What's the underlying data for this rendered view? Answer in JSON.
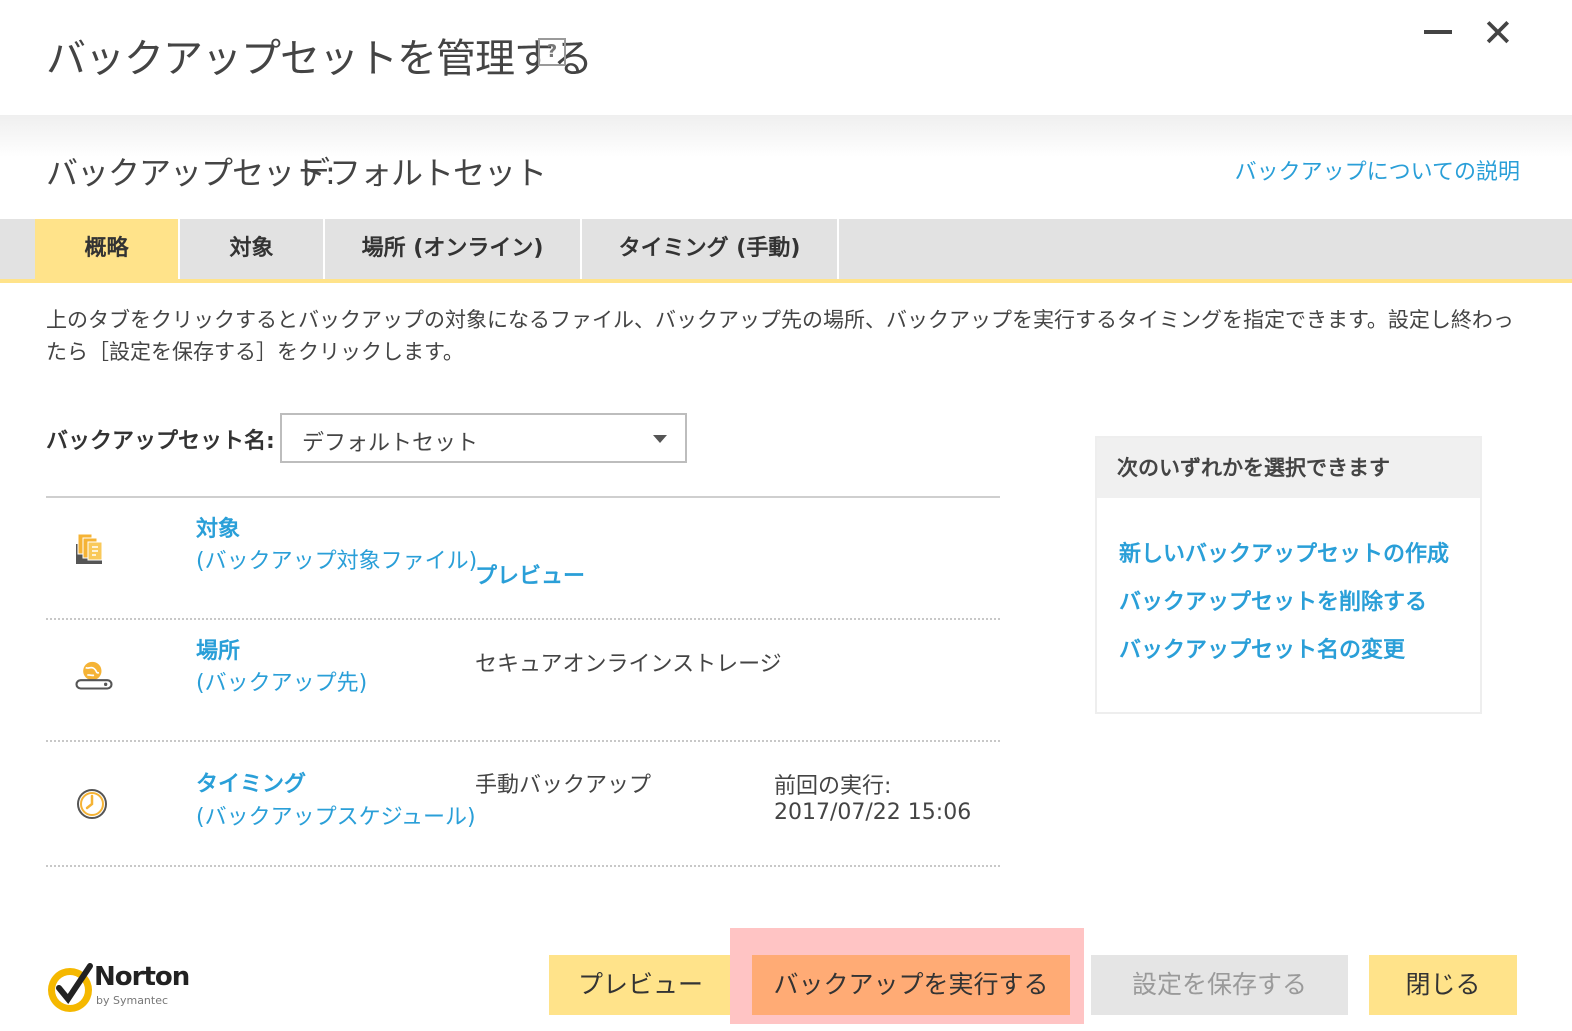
{
  "window": {
    "title": "バックアップセットを管理する",
    "help_icon": "?",
    "minimize_icon": "minimize-icon",
    "close_glyph": "✕"
  },
  "header": {
    "set_label": "バックアップセット:",
    "set_value": "デフォルトセット",
    "help_link": "バックアップについての説明"
  },
  "tabs": [
    {
      "label": "概略",
      "active": true
    },
    {
      "label": "対象",
      "active": false
    },
    {
      "label": "場所 (オンライン)",
      "active": false
    },
    {
      "label": "タイミング (手動)",
      "active": false
    }
  ],
  "description": "上のタブをクリックするとバックアップの対象になるファイル、バックアップ先の場所、バックアップを実行するタイミングを指定できます。設定し終わったら［設定を保存する］をクリックします。",
  "name_field": {
    "label": "バックアップセット名:",
    "selected": "デフォルトセット"
  },
  "rows": {
    "target": {
      "title": "対象",
      "subtitle": "(バックアップ対象ファイル)",
      "action": "プレビュー",
      "icon": "files-icon"
    },
    "location": {
      "title": "場所",
      "subtitle": "(バックアップ先)",
      "value": "セキュアオンラインストレージ",
      "icon": "online-storage-icon"
    },
    "timing": {
      "title": "タイミング",
      "subtitle": "(バックアップスケジュール)",
      "value": "手動バックアップ",
      "last_run_label": "前回の実行:",
      "last_run_value": "2017/07/22 15:06",
      "icon": "clock-icon"
    }
  },
  "panel": {
    "heading": "次のいずれかを選択できます",
    "links": [
      "新しいバックアップセットの作成",
      "バックアップセットを削除する",
      "バックアップセット名の変更"
    ]
  },
  "footer": {
    "logo_text": "Norton",
    "logo_sub": "by Symantec",
    "preview_button": "プレビュー",
    "run_button": "バックアップを実行する",
    "save_button": "設定を保存する",
    "close_button": "閉じる"
  },
  "colors": {
    "accent_yellow": "#ffe38a",
    "accent_orange": "#ffab75",
    "link_blue": "#2a9fd8",
    "highlight": "#ffc4c4"
  }
}
